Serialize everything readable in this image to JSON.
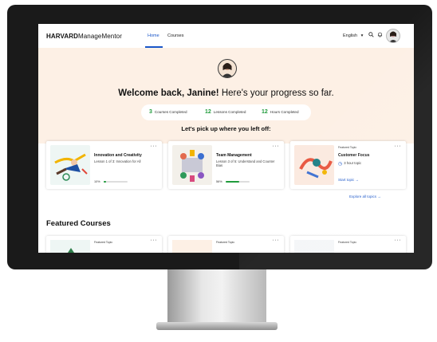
{
  "header": {
    "logo_bold": "HARVARD",
    "logo_light": "ManageMentor",
    "nav": [
      "Home",
      "Courses"
    ],
    "language": "English",
    "lang_caret": "▾",
    "search_icon": "search-icon",
    "bell_icon": "bell-icon"
  },
  "hero": {
    "welcome_bold": "Welcome back, Janine!",
    "welcome_rest": "Here's your progress so far.",
    "stats": [
      {
        "num": "3",
        "label": "Courses Completed"
      },
      {
        "num": "12",
        "label": "Lessons Completed"
      },
      {
        "num": "12",
        "label": "Hours Completed"
      }
    ],
    "pickup": "Let's pick up where you left off:"
  },
  "cards": [
    {
      "title": "Innovation and Creativity",
      "subtitle": "Lesson 1 of 3: Innovation for All",
      "progress_label": "10%",
      "progress": 0.1
    },
    {
      "title": "Team Management",
      "subtitle": "Lesson 3 of 5: Understand and Counter Bias",
      "progress_label": "56%",
      "progress": 0.56
    },
    {
      "badge": "Featured Topic",
      "title": "Customer Focus",
      "timeline": "3 hour topic",
      "cta": "Start topic →"
    }
  ],
  "menu_dots": "···",
  "explore_link": "Explore all topics →",
  "featured": {
    "heading": "Featured Courses",
    "cards": [
      {
        "badge": "Featured Topic"
      },
      {
        "badge": "Featured Topic"
      },
      {
        "badge": "Featured Topic"
      }
    ]
  },
  "colors": {
    "accent": "#1a56c9",
    "success": "#1f9b3b",
    "hero_bg": "#fdf0e5"
  }
}
